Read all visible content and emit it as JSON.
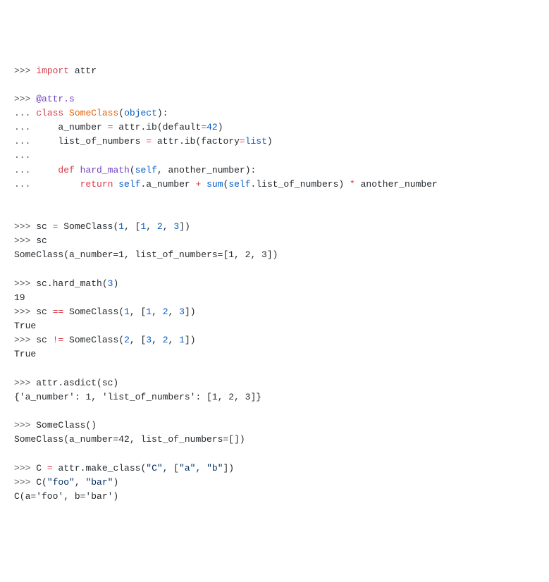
{
  "lines": [
    {
      "segments": [
        {
          "cls": "prompt",
          "t": ">>> "
        },
        {
          "cls": "kw-import",
          "t": "import"
        },
        {
          "cls": "plain",
          "t": " attr"
        }
      ]
    },
    {
      "segments": [
        {
          "cls": "plain",
          "t": ""
        }
      ]
    },
    {
      "segments": [
        {
          "cls": "prompt",
          "t": ">>> "
        },
        {
          "cls": "decorator",
          "t": "@attr.s"
        }
      ]
    },
    {
      "segments": [
        {
          "cls": "prompt",
          "t": "... "
        },
        {
          "cls": "kw-class",
          "t": "class"
        },
        {
          "cls": "plain",
          "t": " "
        },
        {
          "cls": "classname",
          "t": "SomeClass"
        },
        {
          "cls": "plain",
          "t": "("
        },
        {
          "cls": "builtin",
          "t": "object"
        },
        {
          "cls": "plain",
          "t": "):"
        }
      ]
    },
    {
      "segments": [
        {
          "cls": "prompt",
          "t": "...     "
        },
        {
          "cls": "plain",
          "t": "a_number "
        },
        {
          "cls": "op",
          "t": "="
        },
        {
          "cls": "plain",
          "t": " attr.ib(default"
        },
        {
          "cls": "op",
          "t": "="
        },
        {
          "cls": "num",
          "t": "42"
        },
        {
          "cls": "plain",
          "t": ")"
        }
      ]
    },
    {
      "segments": [
        {
          "cls": "prompt",
          "t": "...     "
        },
        {
          "cls": "plain",
          "t": "list_of_numbers "
        },
        {
          "cls": "op",
          "t": "="
        },
        {
          "cls": "plain",
          "t": " attr.ib(factory"
        },
        {
          "cls": "op",
          "t": "="
        },
        {
          "cls": "builtin",
          "t": "list"
        },
        {
          "cls": "plain",
          "t": ")"
        }
      ]
    },
    {
      "segments": [
        {
          "cls": "prompt",
          "t": "..."
        }
      ]
    },
    {
      "segments": [
        {
          "cls": "prompt",
          "t": "...     "
        },
        {
          "cls": "kw-def",
          "t": "def"
        },
        {
          "cls": "plain",
          "t": " "
        },
        {
          "cls": "funcdef",
          "t": "hard_math"
        },
        {
          "cls": "plain",
          "t": "("
        },
        {
          "cls": "builtin",
          "t": "self"
        },
        {
          "cls": "plain",
          "t": ", another_number):"
        }
      ]
    },
    {
      "segments": [
        {
          "cls": "prompt",
          "t": "...         "
        },
        {
          "cls": "kw-return",
          "t": "return"
        },
        {
          "cls": "plain",
          "t": " "
        },
        {
          "cls": "builtin",
          "t": "self"
        },
        {
          "cls": "plain",
          "t": ".a_number "
        },
        {
          "cls": "op",
          "t": "+"
        },
        {
          "cls": "plain",
          "t": " "
        },
        {
          "cls": "builtin",
          "t": "sum"
        },
        {
          "cls": "plain",
          "t": "("
        },
        {
          "cls": "builtin",
          "t": "self"
        },
        {
          "cls": "plain",
          "t": ".list_of_numbers) "
        },
        {
          "cls": "op",
          "t": "*"
        },
        {
          "cls": "plain",
          "t": " another_number"
        }
      ]
    },
    {
      "segments": [
        {
          "cls": "plain",
          "t": ""
        }
      ]
    },
    {
      "segments": [
        {
          "cls": "plain",
          "t": ""
        }
      ]
    },
    {
      "segments": [
        {
          "cls": "prompt",
          "t": ">>> "
        },
        {
          "cls": "plain",
          "t": "sc "
        },
        {
          "cls": "op",
          "t": "="
        },
        {
          "cls": "plain",
          "t": " SomeClass("
        },
        {
          "cls": "num",
          "t": "1"
        },
        {
          "cls": "plain",
          "t": ", ["
        },
        {
          "cls": "num",
          "t": "1"
        },
        {
          "cls": "plain",
          "t": ", "
        },
        {
          "cls": "num",
          "t": "2"
        },
        {
          "cls": "plain",
          "t": ", "
        },
        {
          "cls": "num",
          "t": "3"
        },
        {
          "cls": "plain",
          "t": "])"
        }
      ]
    },
    {
      "segments": [
        {
          "cls": "prompt",
          "t": ">>> "
        },
        {
          "cls": "plain",
          "t": "sc"
        }
      ]
    },
    {
      "segments": [
        {
          "cls": "plain",
          "t": "SomeClass(a_number=1, list_of_numbers=[1, 2, 3])"
        }
      ]
    },
    {
      "segments": [
        {
          "cls": "plain",
          "t": ""
        }
      ]
    },
    {
      "segments": [
        {
          "cls": "prompt",
          "t": ">>> "
        },
        {
          "cls": "plain",
          "t": "sc.hard_math("
        },
        {
          "cls": "num",
          "t": "3"
        },
        {
          "cls": "plain",
          "t": ")"
        }
      ]
    },
    {
      "segments": [
        {
          "cls": "plain",
          "t": "19"
        }
      ]
    },
    {
      "segments": [
        {
          "cls": "prompt",
          "t": ">>> "
        },
        {
          "cls": "plain",
          "t": "sc "
        },
        {
          "cls": "op",
          "t": "=="
        },
        {
          "cls": "plain",
          "t": " SomeClass("
        },
        {
          "cls": "num",
          "t": "1"
        },
        {
          "cls": "plain",
          "t": ", ["
        },
        {
          "cls": "num",
          "t": "1"
        },
        {
          "cls": "plain",
          "t": ", "
        },
        {
          "cls": "num",
          "t": "2"
        },
        {
          "cls": "plain",
          "t": ", "
        },
        {
          "cls": "num",
          "t": "3"
        },
        {
          "cls": "plain",
          "t": "])"
        }
      ]
    },
    {
      "segments": [
        {
          "cls": "plain",
          "t": "True"
        }
      ]
    },
    {
      "segments": [
        {
          "cls": "prompt",
          "t": ">>> "
        },
        {
          "cls": "plain",
          "t": "sc "
        },
        {
          "cls": "op",
          "t": "!="
        },
        {
          "cls": "plain",
          "t": " SomeClass("
        },
        {
          "cls": "num",
          "t": "2"
        },
        {
          "cls": "plain",
          "t": ", ["
        },
        {
          "cls": "num",
          "t": "3"
        },
        {
          "cls": "plain",
          "t": ", "
        },
        {
          "cls": "num",
          "t": "2"
        },
        {
          "cls": "plain",
          "t": ", "
        },
        {
          "cls": "num",
          "t": "1"
        },
        {
          "cls": "plain",
          "t": "])"
        }
      ]
    },
    {
      "segments": [
        {
          "cls": "plain",
          "t": "True"
        }
      ]
    },
    {
      "segments": [
        {
          "cls": "plain",
          "t": ""
        }
      ]
    },
    {
      "segments": [
        {
          "cls": "prompt",
          "t": ">>> "
        },
        {
          "cls": "plain",
          "t": "attr.asdict(sc)"
        }
      ]
    },
    {
      "segments": [
        {
          "cls": "plain",
          "t": "{'a_number': 1, 'list_of_numbers': [1, 2, 3]}"
        }
      ]
    },
    {
      "segments": [
        {
          "cls": "plain",
          "t": ""
        }
      ]
    },
    {
      "segments": [
        {
          "cls": "prompt",
          "t": ">>> "
        },
        {
          "cls": "plain",
          "t": "SomeClass()"
        }
      ]
    },
    {
      "segments": [
        {
          "cls": "plain",
          "t": "SomeClass(a_number=42, list_of_numbers=[])"
        }
      ]
    },
    {
      "segments": [
        {
          "cls": "plain",
          "t": ""
        }
      ]
    },
    {
      "segments": [
        {
          "cls": "prompt",
          "t": ">>> "
        },
        {
          "cls": "plain",
          "t": "C "
        },
        {
          "cls": "op",
          "t": "="
        },
        {
          "cls": "plain",
          "t": " attr.make_class("
        },
        {
          "cls": "str",
          "t": "\"C\""
        },
        {
          "cls": "plain",
          "t": ", ["
        },
        {
          "cls": "str",
          "t": "\"a\""
        },
        {
          "cls": "plain",
          "t": ", "
        },
        {
          "cls": "str",
          "t": "\"b\""
        },
        {
          "cls": "plain",
          "t": "])"
        }
      ]
    },
    {
      "segments": [
        {
          "cls": "prompt",
          "t": ">>> "
        },
        {
          "cls": "plain",
          "t": "C("
        },
        {
          "cls": "str",
          "t": "\"foo\""
        },
        {
          "cls": "plain",
          "t": ", "
        },
        {
          "cls": "str",
          "t": "\"bar\""
        },
        {
          "cls": "plain",
          "t": ")"
        }
      ]
    },
    {
      "segments": [
        {
          "cls": "plain",
          "t": "C(a='foo', b='bar')"
        }
      ]
    }
  ]
}
